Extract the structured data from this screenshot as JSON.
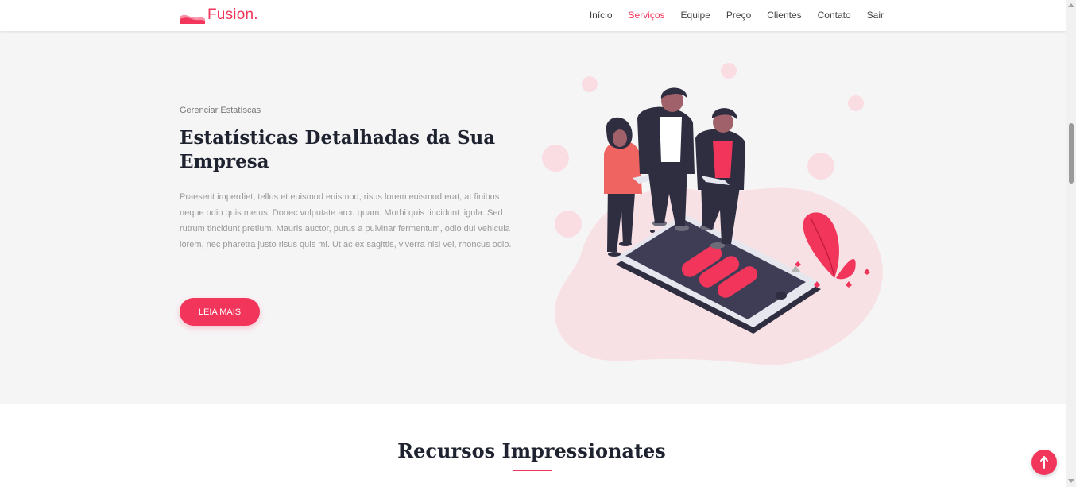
{
  "brand": {
    "name": "Fusion.",
    "logo_icon": "wave-logo-icon"
  },
  "nav": {
    "items": [
      {
        "label": "Início",
        "active": false
      },
      {
        "label": "Serviços",
        "active": true
      },
      {
        "label": "Equipe",
        "active": false
      },
      {
        "label": "Preço",
        "active": false
      },
      {
        "label": "Clientes",
        "active": false
      },
      {
        "label": "Contato",
        "active": false
      },
      {
        "label": "Sair",
        "active": false
      }
    ]
  },
  "hero": {
    "eyebrow": "Gerenciar Estatíscas",
    "title": "Estatísticas Detalhadas da Sua Empresa",
    "description": "Praesent imperdiet, tellus et euismod euismod, risus lorem euismod erat, at finibus neque odio quis metus. Donec vulputate arcu quam. Morbi quis tincidunt ligula. Sed rutrum tincidunt pretium. Mauris auctor, purus a pulvinar fermentum, odio dui vehicula lorem, nec pharetra justo risus quis mi. Ut ac ex sagittis, viverra nisl vel, rhoncus odio.",
    "cta_label": "LEIA MAIS",
    "illustration_icon": "team-with-smartphone-illustration"
  },
  "features": {
    "title": "Recursos Impressionates"
  },
  "back_to_top": {
    "icon": "arrow-up-icon"
  },
  "colors": {
    "accent": "#f2355b",
    "hero_bg": "#f6f5f6",
    "heading": "#1f2330",
    "body_text": "#999999",
    "blob": "#f7e1e5"
  }
}
